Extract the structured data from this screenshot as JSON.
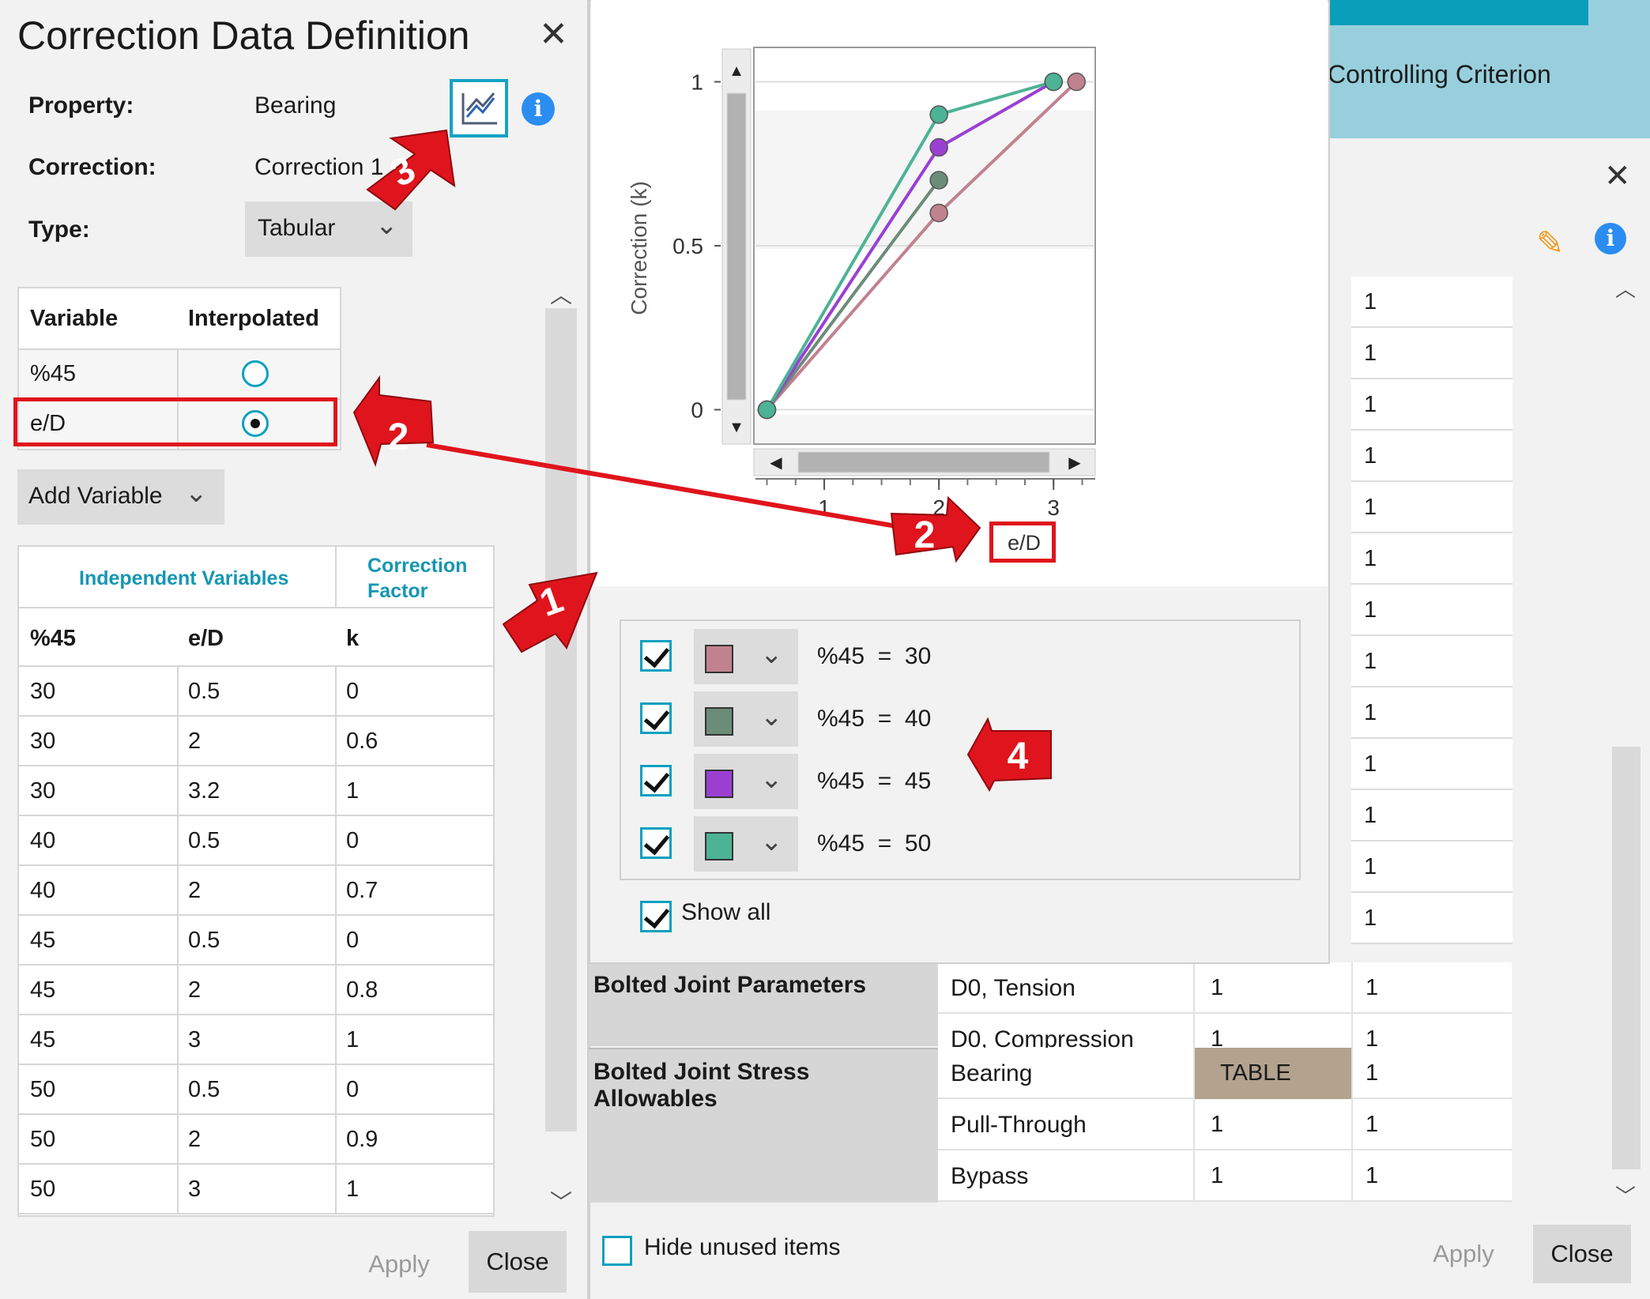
{
  "left_dialog": {
    "title": "Correction Data Definition",
    "property_label": "Property:",
    "property_value": "Bearing",
    "correction_label": "Correction:",
    "correction_value": "Correction 1",
    "type_label": "Type:",
    "type_value": "Tabular",
    "variable_table": {
      "headers": [
        "Variable",
        "Interpolated"
      ],
      "rows": [
        {
          "name": "%45",
          "interpolated": false
        },
        {
          "name": "e/D",
          "interpolated": true
        }
      ]
    },
    "add_variable_label": "Add Variable",
    "data_table": {
      "group_headers": [
        "Independent Variables",
        "Correction",
        "Factor"
      ],
      "columns": [
        "%45",
        "e/D",
        "k"
      ],
      "rows": [
        [
          "30",
          "0.5",
          "0"
        ],
        [
          "30",
          "2",
          "0.6"
        ],
        [
          "30",
          "3.2",
          "1"
        ],
        [
          "40",
          "0.5",
          "0"
        ],
        [
          "40",
          "2",
          "0.7"
        ],
        [
          "45",
          "0.5",
          "0"
        ],
        [
          "45",
          "2",
          "0.8"
        ],
        [
          "45",
          "3",
          "1"
        ],
        [
          "50",
          "0.5",
          "0"
        ],
        [
          "50",
          "2",
          "0.9"
        ],
        [
          "50",
          "3",
          "1"
        ]
      ]
    },
    "apply_label": "Apply",
    "close_label": "Close"
  },
  "chart_popup": {
    "series_toggles": [
      {
        "label": "%45  =  30",
        "color": "#c0828f",
        "checked": true
      },
      {
        "label": "%45  =  40",
        "color": "#6b8c78",
        "checked": true
      },
      {
        "label": "%45  =  45",
        "color": "#9b3fd3",
        "checked": true
      },
      {
        "label": "%45  =  50",
        "color": "#4cb394",
        "checked": true
      }
    ],
    "show_all_label": "Show all"
  },
  "chart_data": {
    "type": "line",
    "xlabel": "e/D",
    "ylabel": "Correction (k)",
    "xlim": [
      0.4,
      3.35
    ],
    "ylim": [
      -0.1,
      1.1
    ],
    "x_ticks": [
      "1",
      "2",
      "3"
    ],
    "y_ticks": [
      "0",
      "0.5",
      "1"
    ],
    "grid": true,
    "series": [
      {
        "name": "%45 = 30",
        "color": "#c0828f",
        "x": [
          0.5,
          2,
          3.2
        ],
        "y": [
          0,
          0.6,
          1
        ]
      },
      {
        "name": "%45 = 40",
        "color": "#6b8c78",
        "x": [
          0.5,
          2
        ],
        "y": [
          0,
          0.7
        ]
      },
      {
        "name": "%45 = 45",
        "color": "#9b3fd3",
        "x": [
          0.5,
          2,
          3
        ],
        "y": [
          0,
          0.8,
          1
        ]
      },
      {
        "name": "%45 = 50",
        "color": "#4cb394",
        "x": [
          0.5,
          2,
          3
        ],
        "y": [
          0,
          0.9,
          1
        ]
      }
    ]
  },
  "background_dialog": {
    "header_text": "Controlling Criterion",
    "right_column_values": [
      "1",
      "1",
      "1",
      "1",
      "1",
      "1",
      "1",
      "1",
      "1",
      "1",
      "1",
      "1",
      "1"
    ],
    "groups": [
      {
        "name": "Bolted Joint Parameters",
        "rows": [
          {
            "name": "D0, Tension",
            "value": "1",
            "value2": "1"
          },
          {
            "name": "D0, Compression",
            "value": "1",
            "value2": "1"
          }
        ]
      },
      {
        "name": "Bolted Joint Stress Allowables",
        "rows": [
          {
            "name": "Bearing",
            "value": "TABLE",
            "value2": "1"
          },
          {
            "name": "Pull-Through",
            "value": "1",
            "value2": "1"
          },
          {
            "name": "Bypass",
            "value": "1",
            "value2": "1"
          }
        ]
      }
    ],
    "hide_unused_label": "Hide unused items",
    "apply_label": "Apply",
    "close_label": "Close"
  },
  "annotations": {
    "badge_1": "1",
    "badge_2": "2",
    "badge_3": "3",
    "badge_4": "4",
    "axis_callout": "e/D",
    "accent_red": "#e0141c"
  }
}
